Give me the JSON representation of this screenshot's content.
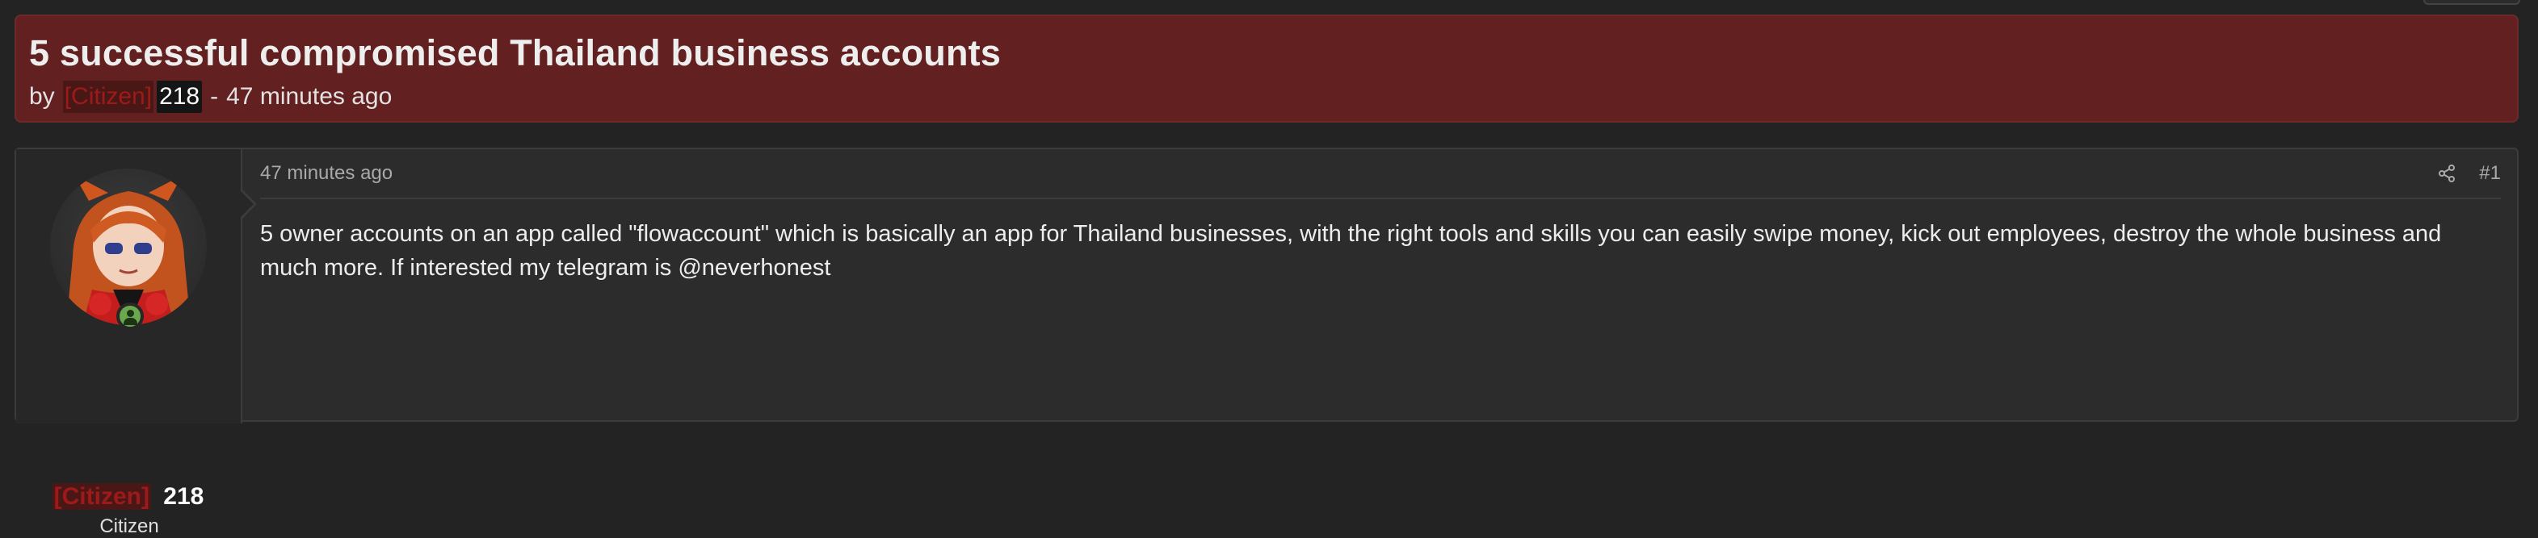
{
  "thread": {
    "title": "5 successful compromised Thailand business accounts",
    "by_label": "by",
    "author_rank": "[Citizen]",
    "author_name": "218",
    "separator": "-",
    "posted_ago": "47 minutes ago"
  },
  "post": {
    "date": "47 minutes ago",
    "number": "#1",
    "body": "5 owner accounts on an app called \"flowaccount\" which is basically an app for Thailand businesses, with the right tools and skills you can easily swipe money, kick out employees, destroy the whole business and much more. If interested my telegram is @neverhonest"
  },
  "user": {
    "rank": "[Citizen]",
    "name": "218",
    "title": "Citizen",
    "status": "online"
  },
  "colors": {
    "background": "#232323",
    "header_bg": "#632020",
    "rank_red": "#9e1a1a",
    "online_green": "#6aa84f"
  },
  "icons": {
    "share": "share-icon",
    "online": "online-status-icon"
  }
}
